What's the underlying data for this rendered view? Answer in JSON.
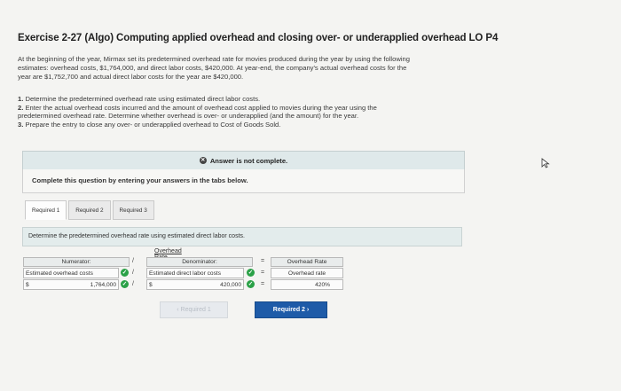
{
  "header": {
    "title": "Exercise 2-27 (Algo) Computing applied overhead and closing over- or underapplied overhead LO P4"
  },
  "intro": {
    "line1": "At the beginning of the year, Mirmax set its predetermined overhead rate for movies produced during the year by using the following",
    "line2": "estimates: overhead costs, $1,764,000, and direct labor costs, $420,000. At year-end, the company's actual overhead costs for the",
    "line3": "year are $1,752,700 and actual direct labor costs for the year are $420,000."
  },
  "steps": [
    {
      "num": "1.",
      "text": "Determine the predetermined overhead rate using estimated direct labor costs."
    },
    {
      "num": "2.",
      "text": "Enter the actual overhead costs incurred and the amount of overhead cost applied to movies during the year using the"
    },
    {
      "num": "",
      "text": "predetermined overhead rate. Determine whether overhead is over- or underapplied (and the amount) for the year."
    },
    {
      "num": "3.",
      "text": "Prepare the entry to close any over- or underapplied overhead to Cost of Goods Sold."
    }
  ],
  "banner": {
    "text": "Answer is not complete.",
    "icon": "x-circle-icon"
  },
  "complete_box": {
    "text": "Complete this question by entering your answers in the tabs below."
  },
  "tabs": [
    {
      "label": "Required 1",
      "active": true
    },
    {
      "label": "Required 2",
      "active": false
    },
    {
      "label": "Required 3",
      "active": false
    }
  ],
  "instruction": "Determine the predetermined overhead rate using estimated direct labor costs.",
  "rate_table": {
    "caption": "Overhead Rate",
    "numerator_header": "Numerator:",
    "denominator_header": "Denominator:",
    "result_header": "Overhead Rate",
    "numerator_label": "Estimated overhead costs",
    "denominator_label": "Estimated direct labor costs",
    "result_label": "Overhead rate",
    "currency_symbol": "$",
    "numerator_value": "1,764,000",
    "denominator_value": "420,000",
    "result_value": "420%",
    "divide_op": "/",
    "equals_op": "="
  },
  "nav": {
    "prev_label": "Required 1",
    "next_label": "Required 2"
  },
  "colors": {
    "accent": "#1e5ba8",
    "check": "#2aa147"
  }
}
